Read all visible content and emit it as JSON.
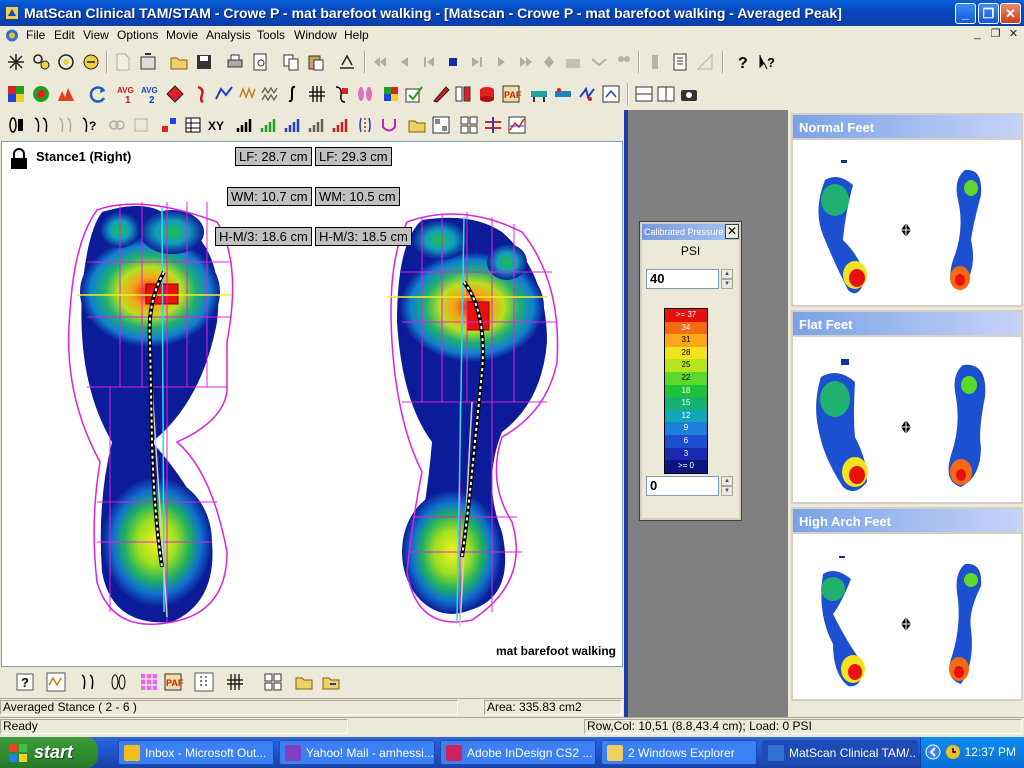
{
  "window": {
    "title": "MatScan Clinical TAM/STAM - Crowe  P - mat barefoot walking - [Matscan - Crowe  P - mat barefoot walking - Averaged Peak]",
    "minimize": "_",
    "maximize": "❐",
    "close": "✕"
  },
  "menu": {
    "items": [
      "File",
      "Edit",
      "View",
      "Options",
      "Movie",
      "Analysis",
      "Tools",
      "Window",
      "Help"
    ],
    "mdi_minimize": "_",
    "mdi_restore": "❐",
    "mdi_close": "✕"
  },
  "plot": {
    "stance_label": "Stance1 (Right)",
    "left_measures": {
      "lf": "LF: 28.7 cm",
      "wm": "WM: 10.7 cm",
      "hm3": "H-M/3: 18.6 cm"
    },
    "right_measures": {
      "lf": "LF: 29.3 cm",
      "wm": "WM: 10.5 cm",
      "hm3": "H-M/3: 18.5 cm"
    },
    "trial_label": "mat barefoot walking"
  },
  "legend": {
    "title": "Calibrated Pressure",
    "close": "✕",
    "unit": "PSI",
    "max_value": "40",
    "min_value": "0",
    "spin_up": "▲",
    "spin_down": "▼",
    "scale": [
      {
        "label": ">= 37",
        "color": "#e8100c"
      },
      {
        "label": "34",
        "color": "#f46a10"
      },
      {
        "label": "31",
        "color": "#fba818"
      },
      {
        "label": "28",
        "color": "#f4e21c"
      },
      {
        "label": "25",
        "color": "#b8e41c"
      },
      {
        "label": "22",
        "color": "#5cd82c"
      },
      {
        "label": "18",
        "color": "#20c038"
      },
      {
        "label": "15",
        "color": "#18b070"
      },
      {
        "label": "12",
        "color": "#10a8b8"
      },
      {
        "label": "9",
        "color": "#1c80d8"
      },
      {
        "label": "6",
        "color": "#1c4cd0"
      },
      {
        "label": "3",
        "color": "#1828b0"
      },
      {
        "label": ">= 0",
        "color": "#0c1480"
      }
    ]
  },
  "reference_panels": [
    {
      "title": "Normal Feet"
    },
    {
      "title": "Flat Feet"
    },
    {
      "title": "High Arch Feet"
    }
  ],
  "status": {
    "stance_info": "Averaged Stance ( 2 - 6 )",
    "area": "Area: 335.83 cm2",
    "ready": "Ready",
    "cursor": "Row,Col: 10,51 (8.8,43.4 cm);  Load: 0 PSI"
  },
  "taskbar": {
    "start": "start",
    "tasks": [
      {
        "label": "Inbox - Microsoft Out...",
        "color": "#f0c020"
      },
      {
        "label": "Yahoo! Mail - amhessi...",
        "color": "#8040c0"
      },
      {
        "label": "Adobe InDesign CS2 ...",
        "color": "#d02060"
      },
      {
        "label": "2 Windows Explorer",
        "color": "#f0d060"
      },
      {
        "label": "MatScan Clinical TAM/...",
        "color": "#3070d0"
      }
    ],
    "clock": "12:37 PM"
  }
}
